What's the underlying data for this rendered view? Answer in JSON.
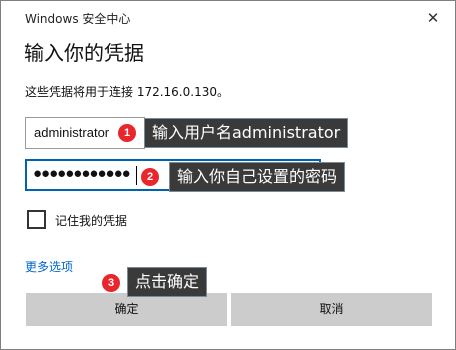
{
  "window": {
    "title": "Windows 安全中心"
  },
  "dialog": {
    "heading": "输入你的凭据",
    "description": "这些凭据将用于连接 172.16.0.130。"
  },
  "fields": {
    "username_value": "administrator",
    "password_value": "●●●●●●●●●●●●"
  },
  "remember": {
    "label": "记住我的凭据",
    "checked": false
  },
  "more_options": "更多选项",
  "buttons": {
    "ok": "确定",
    "cancel": "取消"
  },
  "annotations": [
    {
      "number": "1",
      "text": "输入用户名administrator"
    },
    {
      "number": "2",
      "text": "输入你自己设置的密码"
    },
    {
      "number": "3",
      "text": "点击确定"
    }
  ],
  "icons": {
    "close": "close-icon",
    "checkbox": "checkbox-icon"
  },
  "colors": {
    "link": "#0066cc",
    "focus_border": "#0063b1",
    "badge": "#e8262c",
    "tip_bg": "#3a3a3a",
    "button_bg": "#cccccc"
  }
}
